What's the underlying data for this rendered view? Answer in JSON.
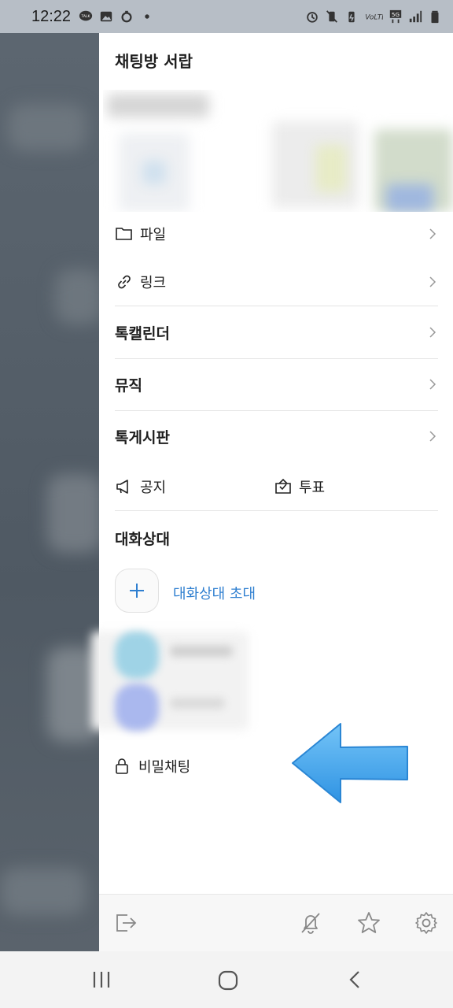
{
  "status_bar": {
    "time": "12:22",
    "left_icons": [
      "talk-icon",
      "image-icon",
      "recycle-icon",
      "dot-icon"
    ],
    "right_icons": [
      "alarm-icon",
      "vibrate-icon",
      "battery-saver-icon",
      "volte-icon",
      "5g-icon",
      "signal-icon",
      "battery-icon"
    ]
  },
  "drawer": {
    "title": "채팅방 서랍",
    "items": [
      {
        "label": "파일",
        "icon": "folder-icon"
      },
      {
        "label": "링크",
        "icon": "link-icon"
      },
      {
        "label": "톡캘린더"
      },
      {
        "label": "뮤직"
      },
      {
        "label": "톡게시판"
      }
    ],
    "notice_label": "공지",
    "vote_label": "투표",
    "participants_title": "대화상대",
    "invite_label": "대화상대 초대",
    "secret_chat_label": "비밀채팅"
  },
  "bottom_bar": {
    "icons": [
      "exit-icon",
      "mute-bell-icon",
      "star-icon",
      "settings-icon"
    ]
  },
  "nav_bar": {
    "icons": [
      "recents-icon",
      "home-icon",
      "back-icon"
    ]
  },
  "colors": {
    "accent": "#2f7fd0",
    "arrow": "#4aa8ef",
    "backdrop": "#56606a"
  }
}
